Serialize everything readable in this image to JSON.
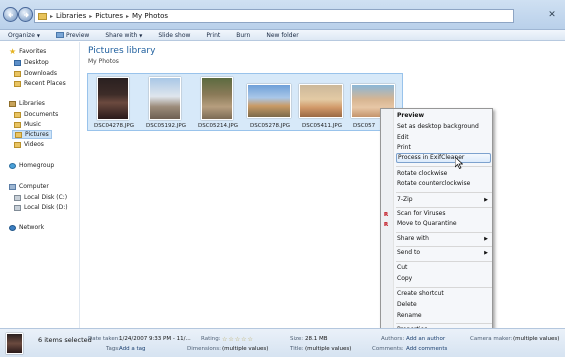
{
  "address": {
    "crumbs": [
      "Libraries",
      "Pictures",
      "My Photos"
    ]
  },
  "toolbar": {
    "organize": "Organize",
    "preview": "Preview",
    "share_with": "Share with",
    "slide_show": "Slide show",
    "print": "Print",
    "burn": "Burn",
    "new_folder": "New folder"
  },
  "sidebar": {
    "favorites": "Favorites",
    "desktop": "Desktop",
    "downloads": "Downloads",
    "recent_places": "Recent Places",
    "libraries": "Libraries",
    "documents": "Documents",
    "music": "Music",
    "pictures": "Pictures",
    "videos": "Videos",
    "homegroup": "Homegroup",
    "computer": "Computer",
    "local_c": "Local Disk (C:)",
    "local_d": "Local Disk (D:)",
    "network": "Network"
  },
  "main": {
    "title": "Pictures library",
    "subtitle": "My Photos",
    "files": [
      "DSC04278.JPG",
      "DSC05192.JPG",
      "DSC05214.JPG",
      "DSC05278.JPG",
      "DSC05411.JPG",
      "DSC057"
    ]
  },
  "context_menu": {
    "preview": "Preview",
    "set_desktop": "Set as desktop background",
    "edit": "Edit",
    "print": "Print",
    "exifcleaner": "Process in ExifCleaner",
    "rotate_cw": "Rotate clockwise",
    "rotate_ccw": "Rotate counterclockwise",
    "sevenzip": "7-Zip",
    "scan": "Scan for Viruses",
    "quarantine": "Move to Quarantine",
    "share_with": "Share with",
    "send_to": "Send to",
    "cut": "Cut",
    "copy": "Copy",
    "create_shortcut": "Create shortcut",
    "delete": "Delete",
    "rename": "Rename",
    "properties": "Properties"
  },
  "details": {
    "count": "6 items selected",
    "date_taken_label": "Date taken:",
    "date_taken": "1/24/2007 9:33 PM - 11/...",
    "tags_label": "Tags:",
    "tags": "Add a tag",
    "rating_label": "Rating:",
    "dimensions_label": "Dimensions:",
    "dimensions": "(multiple values)",
    "size_label": "Size:",
    "size": "28.1 MB",
    "title_label": "Title:",
    "title": "(multiple values)",
    "authors_label": "Authors:",
    "authors": "Add an author",
    "comments_label": "Comments:",
    "comments": "Add comments",
    "camera_label": "Camera maker:",
    "camera": "(multiple values)"
  }
}
